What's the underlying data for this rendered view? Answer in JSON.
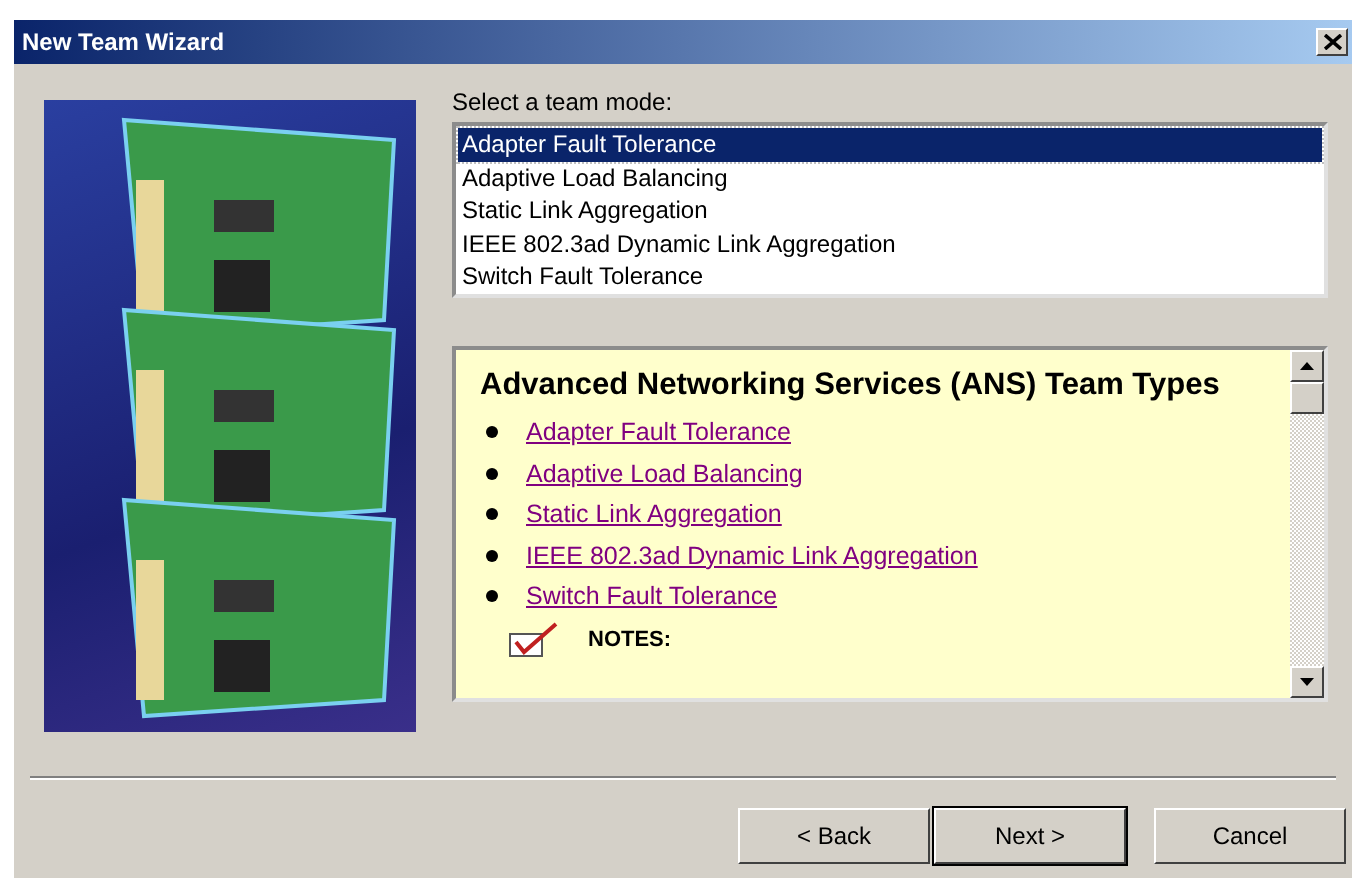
{
  "window": {
    "title": "New Team Wizard"
  },
  "team_mode": {
    "label": "Select a team mode:",
    "options": [
      {
        "label": "Adapter Fault Tolerance",
        "selected": true
      },
      {
        "label": "Adaptive Load Balancing",
        "selected": false
      },
      {
        "label": "Static Link Aggregation",
        "selected": false
      },
      {
        "label": "IEEE 802.3ad Dynamic Link Aggregation",
        "selected": false
      },
      {
        "label": "Switch Fault Tolerance",
        "selected": false
      }
    ]
  },
  "info_panel": {
    "heading": "Advanced Networking Services (ANS) Team Types",
    "links": [
      "Adapter Fault Tolerance",
      "Adaptive Load Balancing",
      "Static Link Aggregation",
      "IEEE 802.3ad Dynamic Link Aggregation",
      "Switch Fault Tolerance"
    ],
    "notes_label": "NOTES:"
  },
  "buttons": [
    {
      "label": "< Back",
      "default": false
    },
    {
      "label": "Next >",
      "default": true
    },
    {
      "label": "Cancel",
      "default": false
    }
  ]
}
